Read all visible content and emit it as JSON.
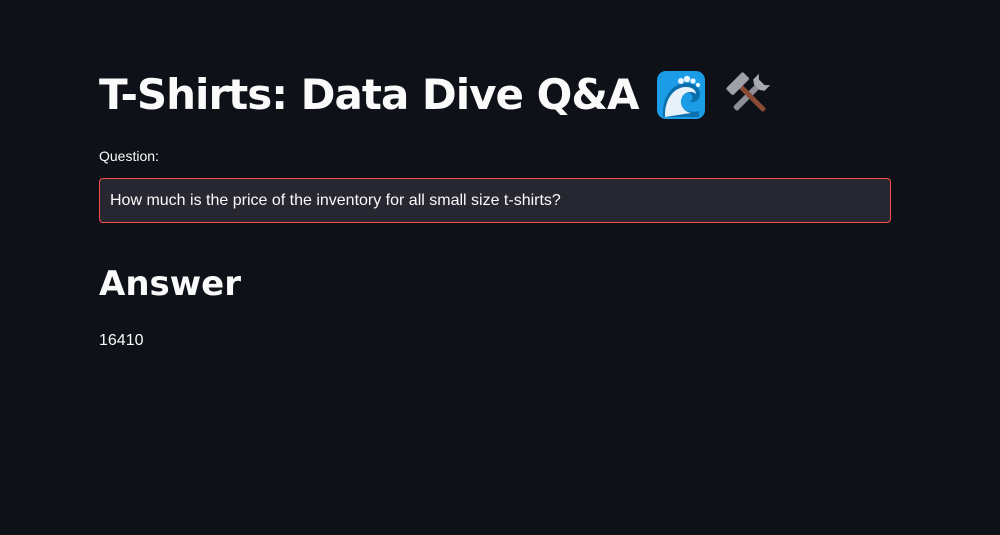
{
  "header": {
    "title": "T-Shirts: Data Dive Q&A",
    "icons": [
      "water-wave-icon",
      "hammer-and-wrench-icon"
    ]
  },
  "question": {
    "label": "Question:",
    "value": "How much is the price of the inventory for all small size t-shirts?"
  },
  "answer": {
    "heading": "Answer",
    "value": "16410"
  },
  "colors": {
    "background": "#0e1117",
    "text": "#fafafa",
    "input_background": "#262730",
    "input_border_focus": "#ff4b4b"
  }
}
